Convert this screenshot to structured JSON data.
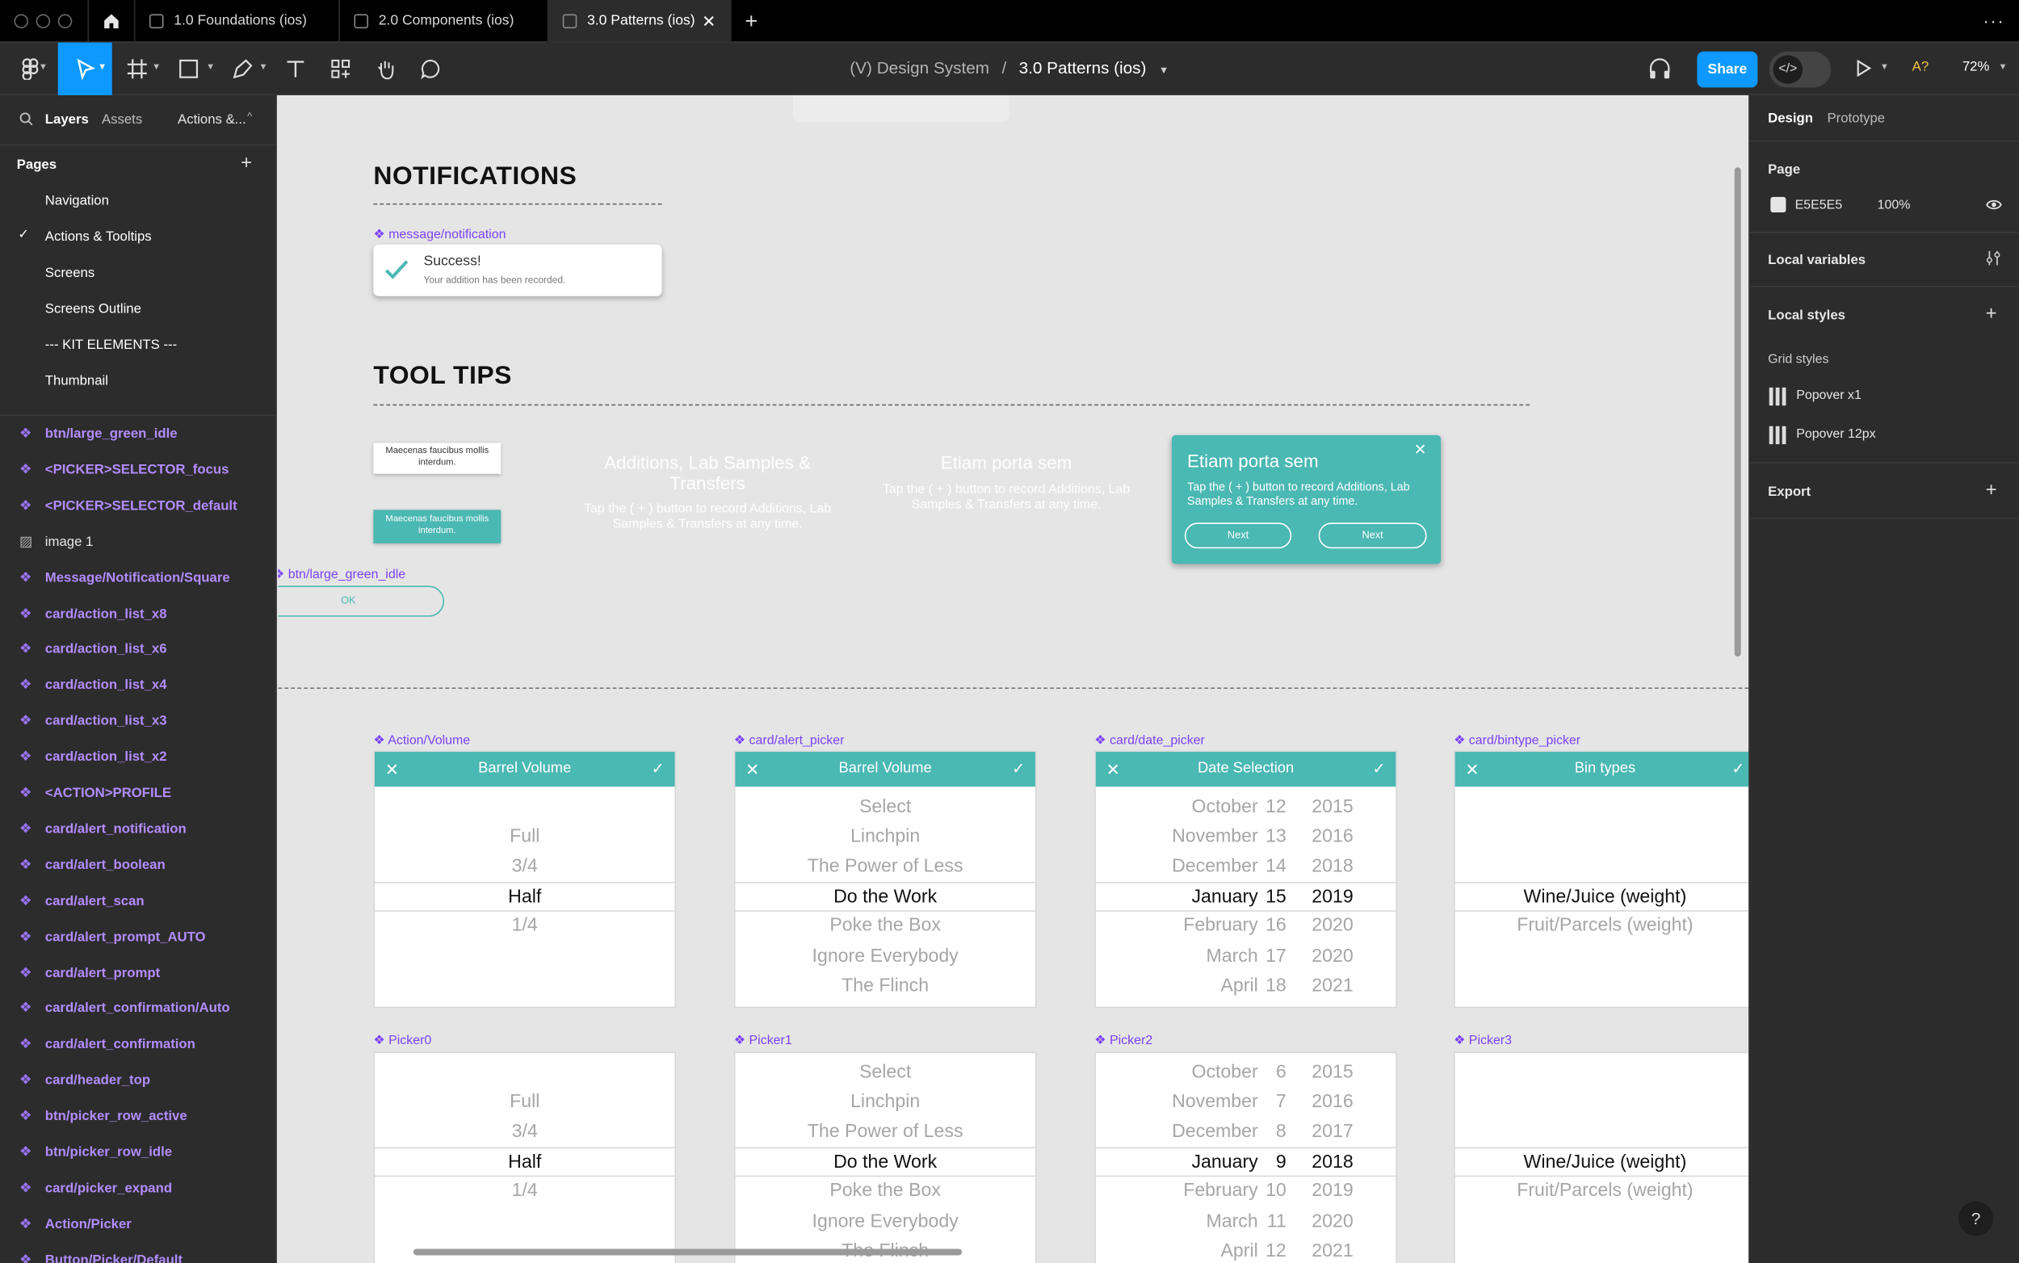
{
  "tabs": {
    "t1": "1.0 Foundations (ios)",
    "t2": "2.0 Components (ios)",
    "t3": "3.0 Patterns (ios)"
  },
  "toolbar": {
    "project": "(V) Design System",
    "sep": "/",
    "file": "3.0 Patterns (ios)",
    "share": "Share",
    "avatar": "A?",
    "zoom": "72%"
  },
  "left": {
    "tab_layers": "Layers",
    "tab_assets": "Assets",
    "tab_page": "Actions &...",
    "pages_title": "Pages",
    "pages": [
      "Navigation",
      "Actions & Tooltips",
      "Screens",
      "Screens Outline",
      "--- KIT ELEMENTS ---",
      "Thumbnail"
    ],
    "layers": [
      "btn/large_green_idle",
      "<PICKER>SELECTOR_focus",
      "<PICKER>SELECTOR_default",
      "image 1",
      "Message/Notification/Square",
      "card/action_list_x8",
      "card/action_list_x6",
      "card/action_list_x4",
      "card/action_list_x3",
      "card/action_list_x2",
      "<ACTION>PROFILE",
      "card/alert_notification",
      "card/alert_boolean",
      "card/alert_scan",
      "card/alert_prompt_AUTO",
      "card/alert_prompt",
      "card/alert_confirmation/Auto",
      "card/alert_confirmation",
      "card/header_top",
      "btn/picker_row_active",
      "btn/picker_row_idle",
      "card/picker_expand",
      "Action/Picker",
      "Button/Picker/Default"
    ]
  },
  "right": {
    "tab_design": "Design",
    "tab_proto": "Prototype",
    "page": "Page",
    "page_color": "E5E5E5",
    "page_opacity": "100%",
    "local_vars": "Local variables",
    "local_styles": "Local styles",
    "grid_styles": "Grid styles",
    "grid1": "Popover x1",
    "grid2": "Popover 12px",
    "export": "Export"
  },
  "canvas": {
    "notifications_title": "NOTIFICATIONS",
    "notif_label": "message/notification",
    "notif_title": "Success!",
    "notif_body": "Your addition has been recorded.",
    "tooltips_title": "TOOL TIPS",
    "tip_small": "Maecenas faucibus mollis interdum.",
    "tip_small2": "Maecenas faucibus mollis interdum.",
    "btn_label": "btn/large_green_idle",
    "btn_text": "OK",
    "ghost1_title": "Additions, Lab Samples & Transfers",
    "ghost1_body": "Tap the ( + ) button to record Additions, Lab Samples & Transfers at any time.",
    "ghost2_title": "Etiam porta sem",
    "ghost2_body": "Tap the ( + ) button to record Additions, Lab Samples & Transfers at any time.",
    "pop_title": "Etiam porta sem",
    "pop_body": "Tap the ( + ) button to record Additions, Lab Samples & Transfers at any time.",
    "pop_next1": "Next",
    "pop_next2": "Next"
  },
  "pickers": [
    {
      "label": "Action/Volume",
      "title": "Barrel Volume",
      "rows": [
        "",
        "Full",
        "3/4",
        "Half",
        "1/4",
        "",
        ""
      ]
    },
    {
      "label": "card/alert_picker",
      "title": "Barrel Volume",
      "rows": [
        "Select",
        "Linchpin",
        "The Power of Less",
        "Do the Work",
        "Poke the Box",
        "Ignore Everybody",
        "The Flinch"
      ]
    },
    {
      "label": "card/date_picker",
      "title": "Date Selection",
      "months": [
        "October",
        "November",
        "December",
        "January",
        "February",
        "March",
        "April"
      ],
      "days": [
        "12",
        "13",
        "14",
        "15",
        "16",
        "17",
        "18"
      ],
      "years": [
        "2015",
        "2016",
        "2018",
        "2019",
        "2020",
        "2020",
        "2021"
      ]
    },
    {
      "label": "card/bintype_picker",
      "title": "Bin types",
      "rows": [
        "",
        "",
        "",
        "Wine/Juice (weight)",
        "Fruit/Parcels (weight)",
        "",
        ""
      ]
    }
  ],
  "pickers2": [
    {
      "label": "Picker0",
      "rows": [
        "",
        "Full",
        "3/4",
        "Half",
        "1/4",
        "",
        ""
      ]
    },
    {
      "label": "Picker1",
      "rows": [
        "Select",
        "Linchpin",
        "The Power of Less",
        "Do the Work",
        "Poke the Box",
        "Ignore Everybody",
        "The Flinch"
      ]
    },
    {
      "label": "Picker2",
      "months": [
        "October",
        "November",
        "December",
        "January",
        "February",
        "March",
        "April"
      ],
      "days": [
        "6",
        "7",
        "8",
        "9",
        "10",
        "11",
        "12"
      ],
      "years": [
        "2015",
        "2016",
        "2017",
        "2018",
        "2019",
        "2020",
        "2021"
      ]
    },
    {
      "label": "Picker3",
      "rows": [
        "",
        "",
        "",
        "Wine/Juice (weight)",
        "Fruit/Parcels (weight)",
        "",
        ""
      ]
    }
  ],
  "colors": {
    "accent": "#4ab8b3",
    "component": "#7b42f6",
    "share": "#0d99ff"
  }
}
